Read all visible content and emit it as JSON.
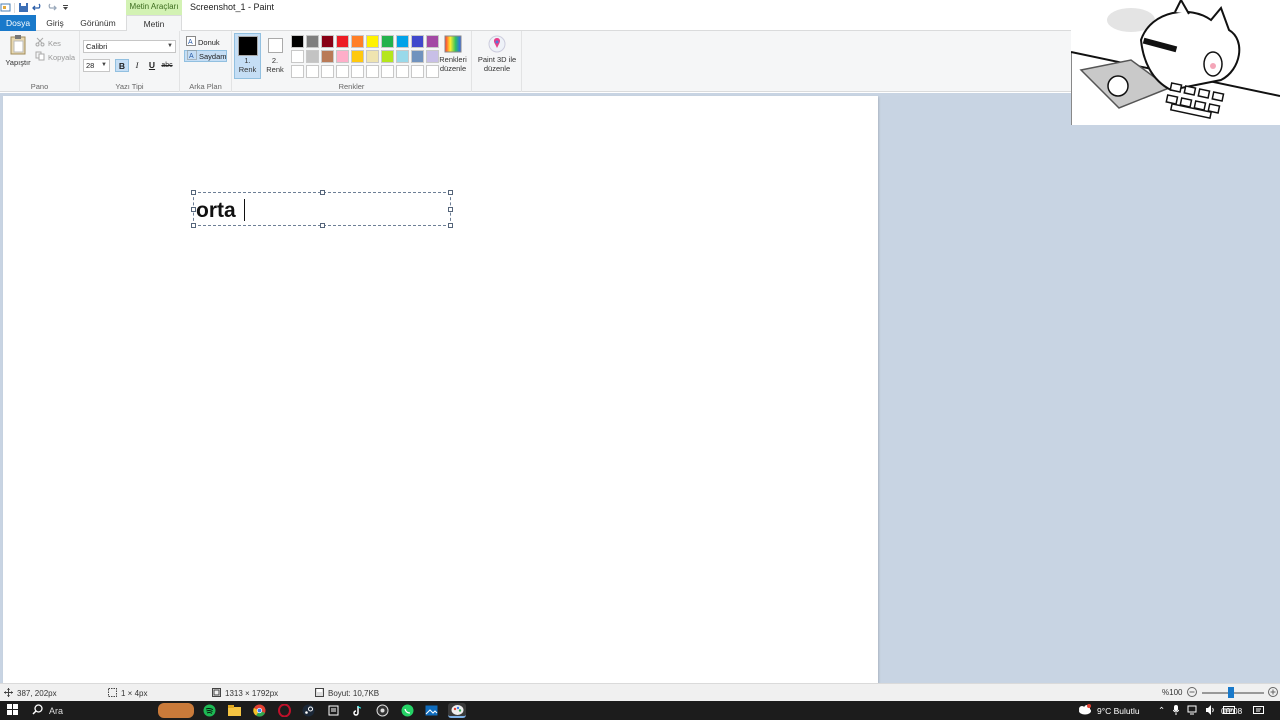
{
  "window": {
    "title": "Screenshot_1 - Paint",
    "context_tab_header": "Metin Araçları"
  },
  "tabs": {
    "file": "Dosya",
    "home": "Giriş",
    "view": "Görünüm",
    "text": "Metin"
  },
  "ribbon": {
    "clipboard": {
      "paste": "Yapıştır",
      "cut": "Kes",
      "copy": "Kopyala",
      "label": "Pano"
    },
    "font": {
      "family": "Calibri",
      "size": "28",
      "bold": "B",
      "italic": "I",
      "underline": "U",
      "strike": "abc",
      "label": "Yazı Tipi"
    },
    "background": {
      "opaque": "Donuk",
      "transparent": "Saydam",
      "label": "Arka Plan"
    },
    "colors": {
      "color1_line1": "1.",
      "color1_line2": "Renk",
      "color2_line1": "2.",
      "color2_line2": "Renk",
      "edit_line1": "Renkleri",
      "edit_line2": "düzenle",
      "label": "Renkler",
      "color1": "#000000",
      "color2": "#ffffff",
      "palette": [
        "#000000",
        "#7f7f7f",
        "#880015",
        "#ed1c24",
        "#ff7f27",
        "#fff200",
        "#22b14c",
        "#00a2e8",
        "#3f48cc",
        "#a349a4",
        "#ffffff",
        "#c3c3c3",
        "#b97a57",
        "#ffaec9",
        "#ffc90e",
        "#efe4b0",
        "#b5e61d",
        "#99d9ea",
        "#7092be",
        "#c8bfe7",
        "#ffffff",
        "#ffffff",
        "#ffffff",
        "#ffffff",
        "#ffffff",
        "#ffffff",
        "#ffffff",
        "#ffffff",
        "#ffffff",
        "#ffffff"
      ]
    },
    "paint3d": {
      "line1": "Paint 3D ile",
      "line2": "düzenle"
    }
  },
  "canvas": {
    "text": "orta"
  },
  "status": {
    "cursor_pos": "387, 202px",
    "selection_size": "1 × 4px",
    "image_size": "1313 × 1792px",
    "file_size": "Boyut: 10,7KB",
    "zoom": "%100"
  },
  "taskbar": {
    "search": "Ara",
    "weather": "9°C  Bulutlu",
    "clock": "00:08"
  }
}
